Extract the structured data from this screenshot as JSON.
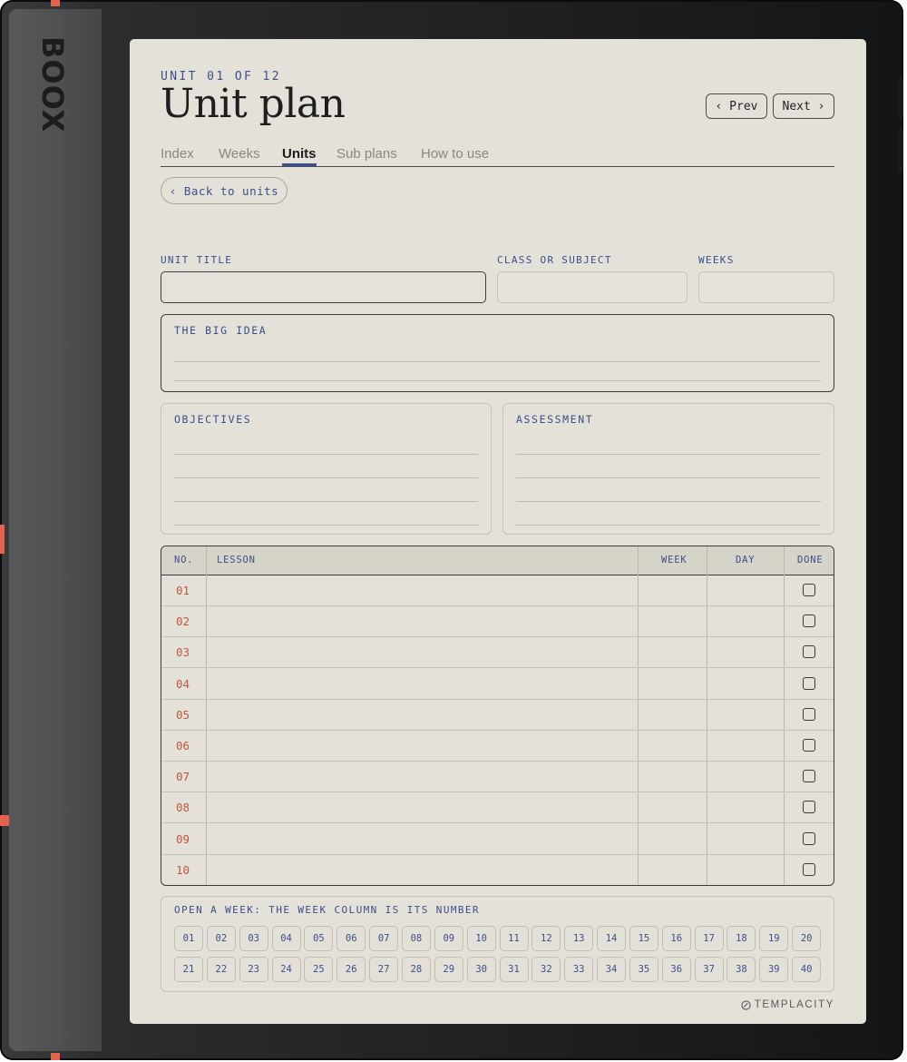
{
  "device": {
    "brand": "BOOX"
  },
  "header": {
    "unit_label": "UNIT 01 OF 12",
    "title": "Unit plan",
    "prev_label": "‹ Prev",
    "next_label": "Next ›"
  },
  "tabs": [
    {
      "label": "Index",
      "active": false
    },
    {
      "label": "Weeks",
      "active": false
    },
    {
      "label": "Units",
      "active": true
    },
    {
      "label": "Sub plans",
      "active": false
    },
    {
      "label": "How to use",
      "active": false
    }
  ],
  "back_button": "‹ Back to units",
  "fields": {
    "unit_title_label": "UNIT TITLE",
    "class_subject_label": "CLASS OR SUBJECT",
    "weeks_label": "WEEKS",
    "unit_title_value": "",
    "class_subject_value": "",
    "weeks_value": ""
  },
  "sections": {
    "big_idea": "THE BIG IDEA",
    "objectives": "OBJECTIVES",
    "assessment": "ASSESSMENT"
  },
  "lessons_table": {
    "headers": {
      "no": "NO.",
      "lesson": "LESSON",
      "week": "WEEK",
      "day": "DAY",
      "done": "DONE"
    },
    "rows": [
      "01",
      "02",
      "03",
      "04",
      "05",
      "06",
      "07",
      "08",
      "09",
      "10"
    ]
  },
  "week_picker": {
    "label": "OPEN A WEEK: THE WEEK COLUMN IS ITS NUMBER",
    "weeks": [
      "01",
      "02",
      "03",
      "04",
      "05",
      "06",
      "07",
      "08",
      "09",
      "10",
      "11",
      "12",
      "13",
      "14",
      "15",
      "16",
      "17",
      "18",
      "19",
      "20",
      "21",
      "22",
      "23",
      "24",
      "25",
      "26",
      "27",
      "28",
      "29",
      "30",
      "31",
      "32",
      "33",
      "34",
      "35",
      "36",
      "37",
      "38",
      "39",
      "40"
    ]
  },
  "footer": {
    "logo": "TEMPLACITY"
  },
  "colors": {
    "accent": "#3b4f8c",
    "row_number": "#c2553f",
    "paper": "#e4e1d8",
    "device_mark": "#e4634f"
  }
}
